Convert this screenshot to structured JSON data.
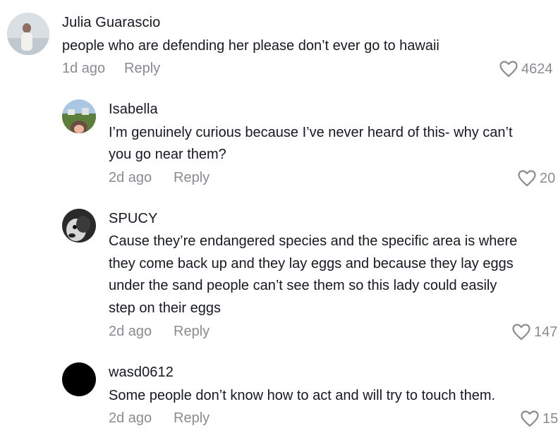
{
  "comments": [
    {
      "username": "Julia Guarascio",
      "text_lines": [
        "people who are defending her please don’t ever go to hawaii"
      ],
      "time": "1d ago",
      "reply_label": "Reply",
      "likes": "4624",
      "avatar_colors": [
        "#cfd8dc",
        "#8d6e63"
      ]
    },
    {
      "username": "Isabella",
      "text_lines": [
        "I’m genuinely curious because I’ve never heard of this- why can’t",
        "you go near them?"
      ],
      "time": "2d ago",
      "reply_label": "Reply",
      "likes": "20",
      "avatar_colors": [
        "#a8c4e0",
        "#5b7f3a"
      ]
    },
    {
      "username": "SPUCY",
      "text_lines": [
        "Cause they’re endangered species and the specific area is where",
        "they come back up and they lay eggs and because they lay eggs",
        "under the sand people can’t see them so this lady could easily",
        "step on their eggs"
      ],
      "time": "2d ago",
      "reply_label": "Reply",
      "likes": "147",
      "avatar_colors": [
        "#2b2b2b",
        "#d9d9d9"
      ]
    },
    {
      "username": "wasd0612",
      "text_lines": [
        "Some people don’t know how to act and will try to touch them."
      ],
      "time": "2d ago",
      "reply_label": "Reply",
      "likes": "15",
      "avatar_colors": [
        "#000000",
        "#000000"
      ]
    }
  ],
  "icons": {
    "like": "heart-outline-icon"
  }
}
